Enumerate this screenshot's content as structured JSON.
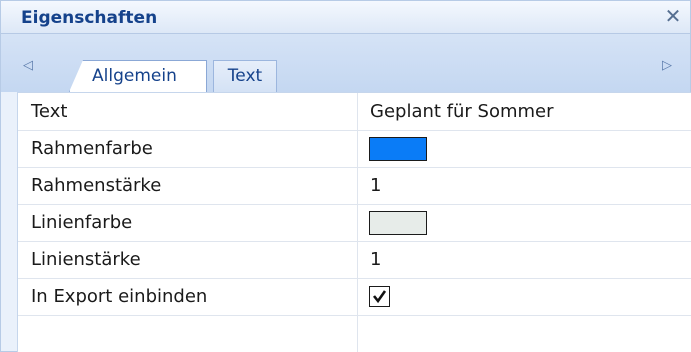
{
  "panel": {
    "title": "Eigenschaften",
    "close_icon": "close-icon"
  },
  "tabs": [
    {
      "label": "Allgemein",
      "active": true
    },
    {
      "label": "Text",
      "active": false
    }
  ],
  "properties": [
    {
      "name": "Text",
      "type": "text",
      "value": "Geplant für Sommer"
    },
    {
      "name": "Rahmenfarbe",
      "type": "color",
      "value": "#0a7cf7"
    },
    {
      "name": "Rahmenstärke",
      "type": "text",
      "value": "1"
    },
    {
      "name": "Linienfarbe",
      "type": "color",
      "value": "#e7ece9"
    },
    {
      "name": "Linienstärke",
      "type": "text",
      "value": "1"
    },
    {
      "name": "In Export einbinden",
      "type": "checkbox",
      "value": true
    }
  ]
}
